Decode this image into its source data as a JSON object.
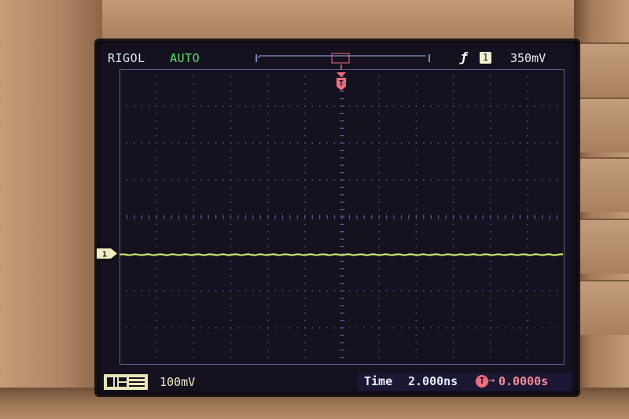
{
  "header": {
    "brand": "RIGOL",
    "trigger_mode": "AUTO",
    "trigger_edge_icon": "rising-edge-icon",
    "trigger_source": "1",
    "trigger_level": "350mV"
  },
  "trigger_marker": {
    "label": "T"
  },
  "channel1": {
    "marker_label": "1",
    "volts_div": "100mV",
    "color": "#c9e46a"
  },
  "footer": {
    "time_label": "Time",
    "time_div": "2.000ns",
    "offset_icon_label": "T",
    "offset_arrow": "→",
    "offset_value": "0.0000s"
  },
  "colors": {
    "screen_bg": "#15111e",
    "grid": "#5a5f9c",
    "brand": "#d7e9f4",
    "mode": "#58e070",
    "trigger": "#f06d7d",
    "trace": "#c9e46a"
  }
}
